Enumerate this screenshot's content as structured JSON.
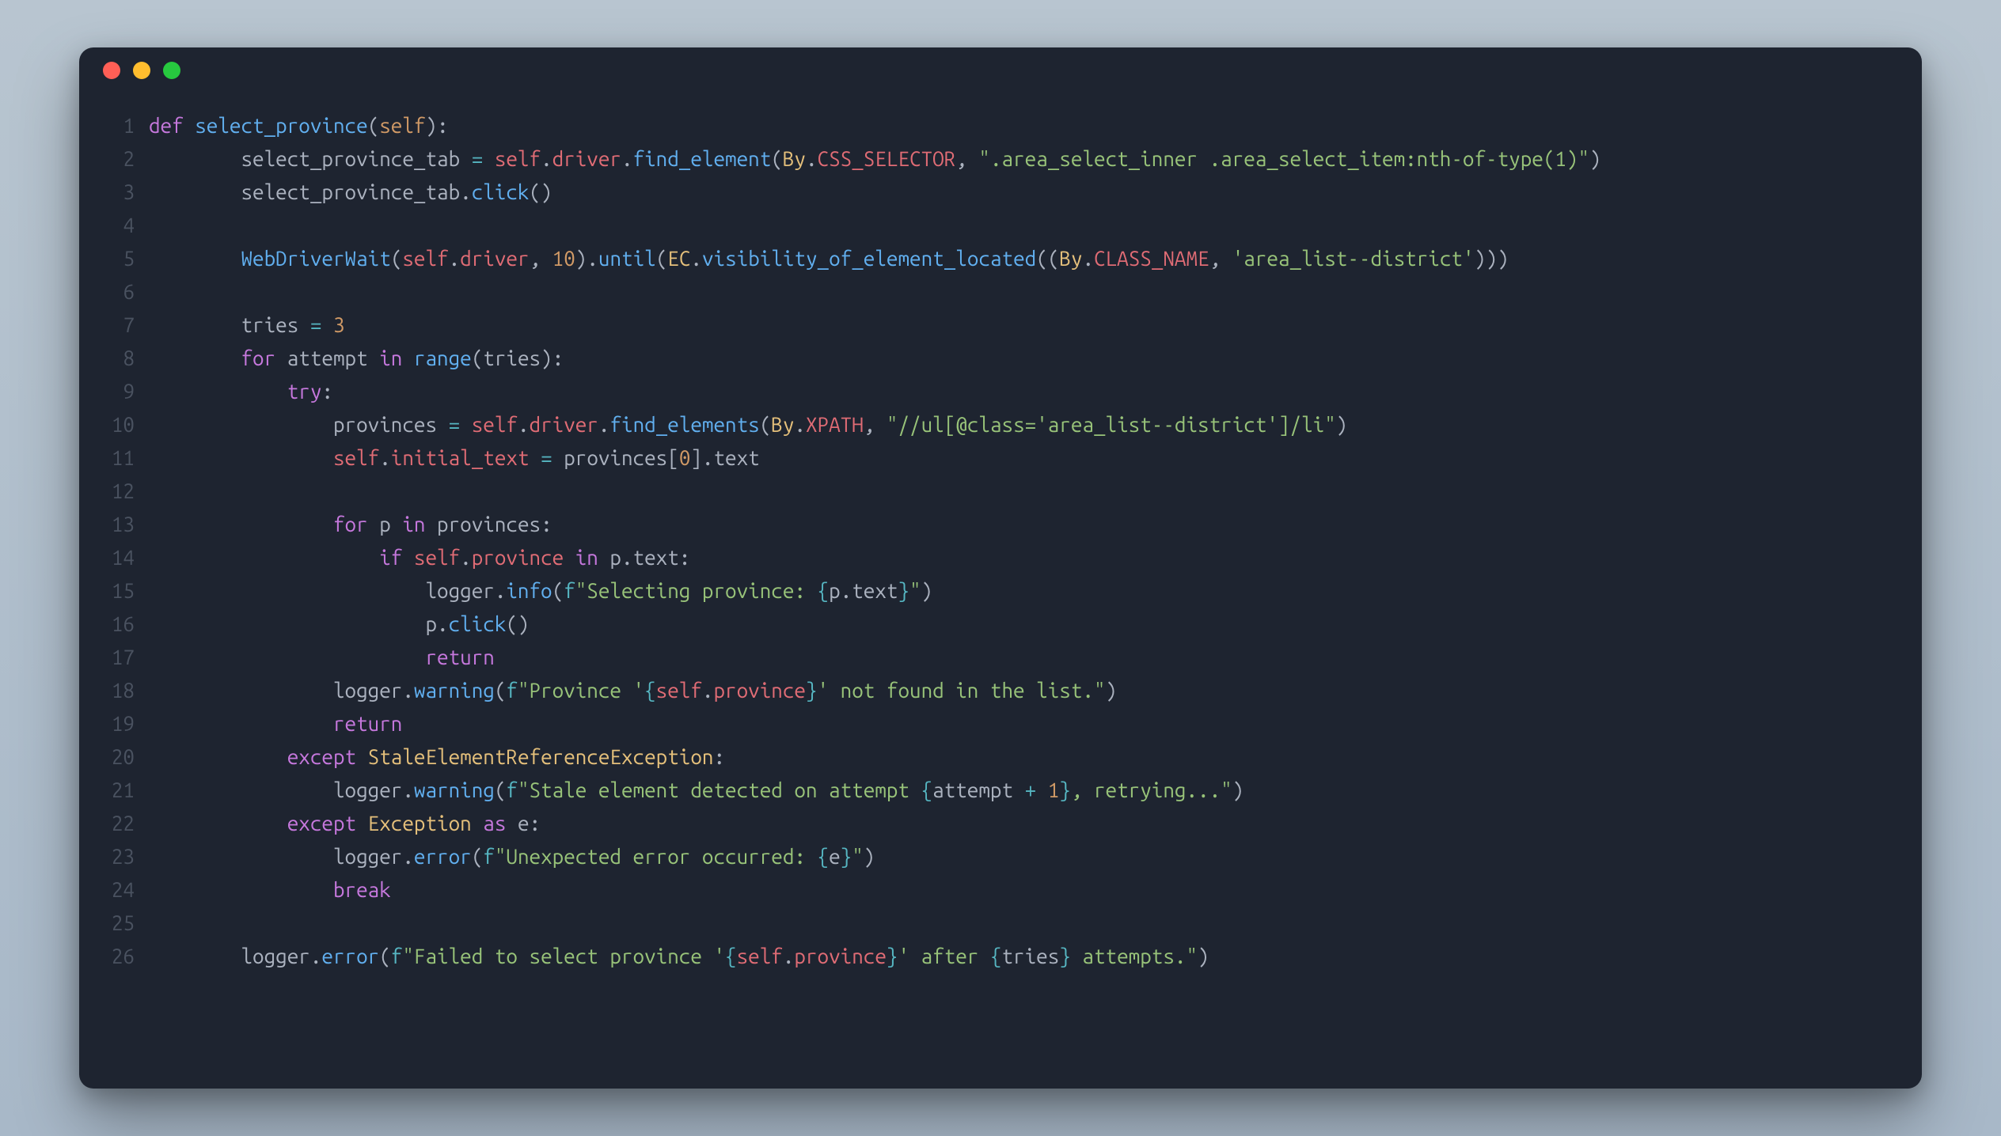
{
  "colors": {
    "background_page": "#b8c5d0",
    "window_bg": "#1e2430",
    "gutter": "#4a5260",
    "keyword": "#c678dd",
    "function": "#61afef",
    "identifier": "#e06c75",
    "class": "#e5c07b",
    "number": "#d19a66",
    "string": "#98c379",
    "format": "#56b6c2",
    "text": "#abb2bf"
  },
  "window_controls": [
    "close",
    "minimize",
    "zoom"
  ],
  "line_count": 26,
  "line_numbers": [
    "1",
    "2",
    "3",
    "4",
    "5",
    "6",
    "7",
    "8",
    "9",
    "10",
    "11",
    "12",
    "13",
    "14",
    "15",
    "16",
    "17",
    "18",
    "19",
    "20",
    "21",
    "22",
    "23",
    "24",
    "25",
    "26"
  ],
  "code_lines_plain": [
    "def select_province(self):",
    "        select_province_tab = self.driver.find_element(By.CSS_SELECTOR, \".area_select_inner .area_select_item:nth-of-type(1)\")",
    "        select_province_tab.click()",
    "",
    "        WebDriverWait(self.driver, 10).until(EC.visibility_of_element_located((By.CLASS_NAME, 'area_list--district')))",
    "",
    "        tries = 3",
    "        for attempt in range(tries):",
    "            try:",
    "                provinces = self.driver.find_elements(By.XPATH, \"//ul[@class='area_list--district']/li\")",
    "                self.initial_text = provinces[0].text",
    "",
    "                for p in provinces:",
    "                    if self.province in p.text:",
    "                        logger.info(f\"Selecting province: {p.text}\")",
    "                        p.click()",
    "                        return",
    "                logger.warning(f\"Province '{self.province}' not found in the list.\")",
    "                return",
    "            except StaleElementReferenceException:",
    "                logger.warning(f\"Stale element detected on attempt {attempt + 1}, retrying...\")",
    "            except Exception as e:",
    "                logger.error(f\"Unexpected error occurred: {e}\")",
    "                break",
    "",
    "        logger.error(f\"Failed to select province '{self.province}' after {tries} attempts.\")"
  ],
  "code_lines_html": [
    "<span class='kw'>def</span> <span class='fn'>select_province</span><span class='txt'>(</span><span class='prm'>self</span><span class='txt'>):</span>",
    "        <span class='txt'>select_province_tab </span><span class='op'>=</span><span class='txt'> </span><span class='id'>self</span><span class='txt'>.</span><span class='id'>driver</span><span class='txt'>.</span><span class='fn'>find_element</span><span class='txt'>(</span><span class='cls'>By</span><span class='txt'>.</span><span class='id'>CSS_SELECTOR</span><span class='txt'>, </span><span class='str'>\".area_select_inner .area_select_item:nth-of-type(1)\"</span><span class='txt'>)</span>",
    "        <span class='txt'>select_province_tab.</span><span class='fn'>click</span><span class='txt'>()</span>",
    "",
    "        <span class='fn'>WebDriverWait</span><span class='txt'>(</span><span class='id'>self</span><span class='txt'>.</span><span class='id'>driver</span><span class='txt'>, </span><span class='num'>10</span><span class='txt'>).</span><span class='fn'>until</span><span class='txt'>(</span><span class='cls'>EC</span><span class='txt'>.</span><span class='fn'>visibility_of_element_located</span><span class='txt'>((</span><span class='cls'>By</span><span class='txt'>.</span><span class='id'>CLASS_NAME</span><span class='txt'>, </span><span class='str'>'area_list--district'</span><span class='txt'>)))</span>",
    "",
    "        <span class='txt'>tries </span><span class='op'>=</span><span class='txt'> </span><span class='num'>3</span>",
    "        <span class='kw'>for</span><span class='txt'> attempt </span><span class='kw'>in</span><span class='txt'> </span><span class='fn'>range</span><span class='txt'>(tries):</span>",
    "            <span class='kw'>try</span><span class='txt'>:</span>",
    "                <span class='txt'>provinces </span><span class='op'>=</span><span class='txt'> </span><span class='id'>self</span><span class='txt'>.</span><span class='id'>driver</span><span class='txt'>.</span><span class='fn'>find_elements</span><span class='txt'>(</span><span class='cls'>By</span><span class='txt'>.</span><span class='id'>XPATH</span><span class='txt'>, </span><span class='str'>\"//ul[@class='area_list--district']/li\"</span><span class='txt'>)</span>",
    "                <span class='id'>self</span><span class='txt'>.</span><span class='id'>initial_text</span><span class='txt'> </span><span class='op'>=</span><span class='txt'> provinces[</span><span class='num'>0</span><span class='txt'>].text</span>",
    "",
    "                <span class='kw'>for</span><span class='txt'> p </span><span class='kw'>in</span><span class='txt'> provinces:</span>",
    "                    <span class='kw'>if</span><span class='txt'> </span><span class='id'>self</span><span class='txt'>.</span><span class='id'>province</span><span class='txt'> </span><span class='kw'>in</span><span class='txt'> p.text:</span>",
    "                        <span class='txt'>logger.</span><span class='fn'>info</span><span class='txt'>(</span><span class='fpre'>f</span><span class='str'>\"Selecting province: </span><span class='fpre'>{</span><span class='txt'>p.text</span><span class='fpre'>}</span><span class='str'>\"</span><span class='txt'>)</span>",
    "                        <span class='txt'>p.</span><span class='fn'>click</span><span class='txt'>()</span>",
    "                        <span class='kw'>return</span>",
    "                <span class='txt'>logger.</span><span class='fn'>warning</span><span class='txt'>(</span><span class='fpre'>f</span><span class='str'>\"Province '</span><span class='fpre'>{</span><span class='id'>self</span><span class='txt'>.</span><span class='id'>province</span><span class='fpre'>}</span><span class='str'>' not found in the list.\"</span><span class='txt'>)</span>",
    "                <span class='kw'>return</span>",
    "            <span class='kw'>except</span><span class='txt'> </span><span class='cls'>StaleElementReferenceException</span><span class='txt'>:</span>",
    "                <span class='txt'>logger.</span><span class='fn'>warning</span><span class='txt'>(</span><span class='fpre'>f</span><span class='str'>\"Stale element detected on attempt </span><span class='fpre'>{</span><span class='txt'>attempt </span><span class='op'>+</span><span class='txt'> </span><span class='num'>1</span><span class='fpre'>}</span><span class='str'>, retrying...\"</span><span class='txt'>)</span>",
    "            <span class='kw'>except</span><span class='txt'> </span><span class='cls'>Exception</span><span class='txt'> </span><span class='kw'>as</span><span class='txt'> e:</span>",
    "                <span class='txt'>logger.</span><span class='fn'>error</span><span class='txt'>(</span><span class='fpre'>f</span><span class='str'>\"Unexpected error occurred: </span><span class='fpre'>{</span><span class='txt'>e</span><span class='fpre'>}</span><span class='str'>\"</span><span class='txt'>)</span>",
    "                <span class='kw'>break</span>",
    "",
    "        <span class='txt'>logger.</span><span class='fn'>error</span><span class='txt'>(</span><span class='fpre'>f</span><span class='str'>\"Failed to select province '</span><span class='fpre'>{</span><span class='id'>self</span><span class='txt'>.</span><span class='id'>province</span><span class='fpre'>}</span><span class='str'>' after </span><span class='fpre'>{</span><span class='txt'>tries</span><span class='fpre'>}</span><span class='str'> attempts.\"</span><span class='txt'>)</span>"
  ]
}
